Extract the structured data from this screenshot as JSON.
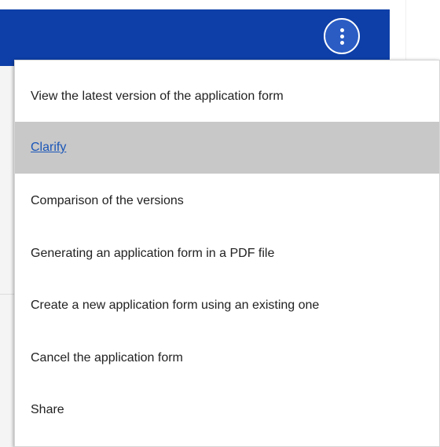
{
  "header": {
    "more_button_icon": "kebab-vertical-icon"
  },
  "colors": {
    "header_bg": "#0e3fa8",
    "active_item_bg": "#c8c8c8",
    "link": "#1a56b8"
  },
  "menu": {
    "items": [
      {
        "label": "View the latest version of the application form"
      },
      {
        "label": "Clarify",
        "active": true
      },
      {
        "label": "Comparison of the versions"
      },
      {
        "label": "Generating an application form in a PDF file"
      },
      {
        "label": "Create a new application form using an existing one"
      },
      {
        "label": "Cancel the application form"
      },
      {
        "label": "Share"
      }
    ]
  }
}
